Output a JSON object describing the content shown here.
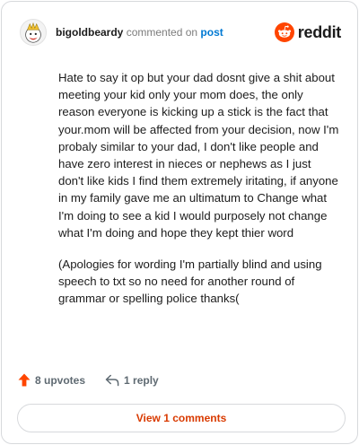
{
  "header": {
    "username": "bigoldbeardy",
    "action_text": "commented on",
    "post_link": "post",
    "brand": "reddit"
  },
  "comment": {
    "paragraphs": [
      "Hate to say it op but your dad dosnt give a shit about meeting your kid only your mom does, the only reason everyone is kicking up a stick is the fact that your.mom will be affected from your decision, now I'm probaly similar to your dad, I don't like people and have zero interest in nieces or nephews as I just don't like kids I find them extremely iritating, if anyone in my family gave me an ultimatum to Change what I'm doing to see a kid I would purposely not change what I'm doing and hope they kept thier word",
      "(Apologies for wording I'm partially blind and using speech to txt so no need for another round of grammar or spelling police thanks("
    ]
  },
  "actions": {
    "upvotes": "8 upvotes",
    "replies": "1 reply"
  },
  "view_comments": "View 1 comments",
  "colors": {
    "upvote": "#ff4500",
    "link": "#0079d3",
    "view_button_text": "#d93a00"
  },
  "icons": [
    "avatar",
    "reddit-logo-icon",
    "upvote-icon",
    "reply-icon"
  ]
}
